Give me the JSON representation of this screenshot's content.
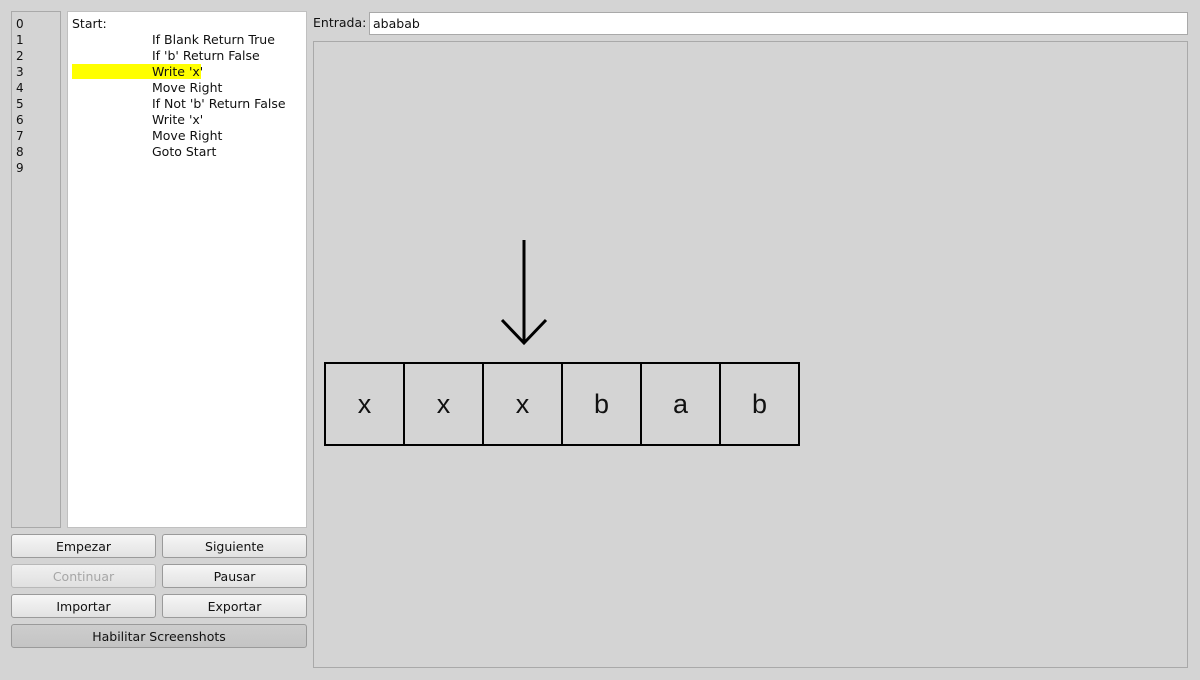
{
  "line_numbers": [
    "0",
    "1",
    "2",
    "3",
    "4",
    "5",
    "6",
    "7",
    "8",
    "9"
  ],
  "program": {
    "lines": [
      {
        "label": "Start:",
        "instr": ""
      },
      {
        "label": "",
        "instr": "If Blank Return True"
      },
      {
        "label": "",
        "instr": "If 'b' Return False"
      },
      {
        "label": "",
        "instr": "Write 'x'"
      },
      {
        "label": "",
        "instr": "Move Right"
      },
      {
        "label": "",
        "instr": "If Not 'b' Return False"
      },
      {
        "label": "",
        "instr": "Write 'x'"
      },
      {
        "label": "",
        "instr": "Move Right"
      },
      {
        "label": "",
        "instr": "Goto Start"
      }
    ],
    "current_line": 3,
    "highlight_color": "#ffff00"
  },
  "buttons": {
    "empezar": "Empezar",
    "siguiente": "Siguiente",
    "continuar": "Continuar",
    "pausar": "Pausar",
    "importar": "Importar",
    "exportar": "Exportar",
    "screenshots": "Habilitar Screenshots"
  },
  "input": {
    "label": "Entrada:",
    "value": "ababab"
  },
  "tape": {
    "cells": [
      "x",
      "x",
      "x",
      "b",
      "a",
      "b"
    ],
    "head_index": 2
  },
  "icons": {
    "head": "down-arrow-icon"
  }
}
